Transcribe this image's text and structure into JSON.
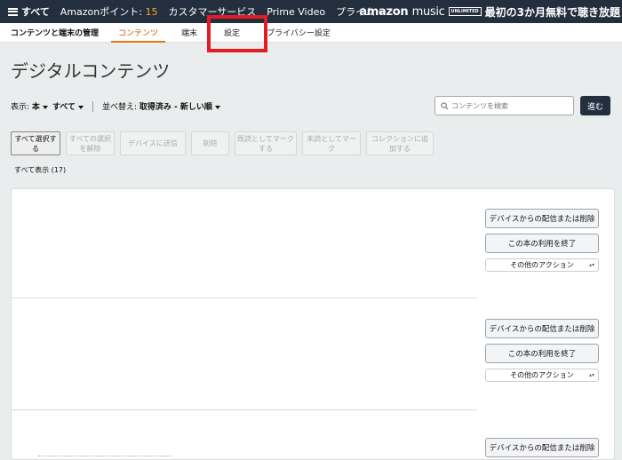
{
  "nav": {
    "all": "すべて",
    "points_label": "Amazonポイント:",
    "points_value": "15",
    "customer_service": "カスタマーサービス",
    "prime_video": "Prime Video",
    "prime": "プライム",
    "music_brand_bold": "amazon",
    "music_brand_light": "music",
    "music_badge": "UNLIMITED",
    "music_promo": "最初の3か月無料で聴き放題"
  },
  "tabs": {
    "manage_title": "コンテンツと端末の管理",
    "items": [
      "コンテンツ",
      "端末",
      "設定",
      "プライバシー設定"
    ]
  },
  "page_title": "デジタルコンテンツ",
  "filters": {
    "show_label": "表示:",
    "show_type": "本",
    "show_scope": "すべて",
    "sort_label": "並べ替え:",
    "sort_value": "取得済み - 新しい順"
  },
  "search": {
    "placeholder": "コンテンツを検索",
    "go": "進む"
  },
  "actions": [
    "すべて選択する",
    "すべての選択を解除",
    "デバイスに送信",
    "削除",
    "既読としてマークする",
    "未読としてマーク",
    "コレクションに追加する"
  ],
  "count": "すべて表示 (17)",
  "item_buttons": {
    "remove": "デバイスからの配信または削除",
    "return": "この本の利用を終了",
    "other": "その他のアクション"
  },
  "colors": {
    "nav_bg": "#232f3e",
    "accent": "#e47911",
    "highlight": "#e31c23"
  }
}
